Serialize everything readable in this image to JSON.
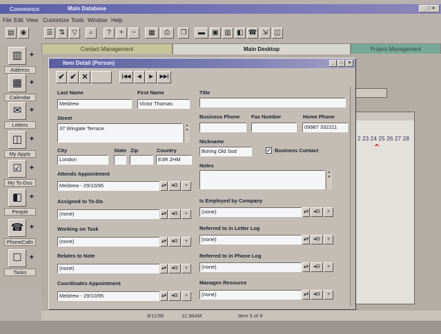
{
  "app": {
    "title_faded": "Commence",
    "title": "Main Database",
    "sys_buttons": "_ □ ×"
  },
  "menu": [
    "File",
    "Edit",
    "View",
    "Customize",
    "Tools",
    "Window",
    "Help"
  ],
  "toolbar_icons": [
    "open-icon",
    "filter-icon",
    "sort-icon",
    "search-icon",
    "help-icon",
    "add-icon",
    "remove-icon",
    "calendar-icon",
    "print-icon",
    "view-icon",
    "agent-icon",
    "phone-icon",
    "bar-icon"
  ],
  "tabs": {
    "left": "Contact Management",
    "center": "Main Desktop",
    "right": "Project Management"
  },
  "sidebar": [
    {
      "label": "Address",
      "icon": "address-book-icon",
      "glyph": "▥"
    },
    {
      "label": "Calendar",
      "icon": "calendar-icon",
      "glyph": "▦"
    },
    {
      "label": "Letters",
      "icon": "letters-icon",
      "glyph": "✉"
    },
    {
      "label": "My Appts",
      "icon": "appointments-icon",
      "glyph": "◫"
    },
    {
      "label": "My To-Dos",
      "icon": "todo-icon",
      "glyph": "☑"
    },
    {
      "label": "People",
      "icon": "people-icon",
      "glyph": "◧"
    },
    {
      "label": "PhoneCalls",
      "icon": "phone-icon",
      "glyph": "☎"
    },
    {
      "label": "Tasks",
      "icon": "tasks-icon",
      "glyph": "☐"
    }
  ],
  "background_calendar": {
    "days": "2 23 24 25 26 27 28"
  },
  "dialog": {
    "title": "Item Detail (Person)",
    "nav_buttons": [
      "✔",
      "✔",
      "✕",
      "",
      "|◀◀",
      "◀",
      "▶",
      "▶▶|"
    ],
    "fields": {
      "last_name_label": "Last Name",
      "last_name": "Meldrew",
      "first_name_label": "First Name",
      "first_name": "Victor Thomas",
      "title_label": "Title",
      "title": "",
      "street_label": "Street",
      "street": "37 Wingate Terrace",
      "business_phone_label": "Business Phone",
      "business_phone": "",
      "fax_label": "Fax Number",
      "fax": "",
      "home_phone_label": "Home Phone",
      "home_phone": "09987 332211",
      "nickname_label": "Nickname",
      "nickname": "Boring Old Sod",
      "business_contact_label": "Business Contact",
      "business_contact_checked": "✓",
      "city_label": "City",
      "city": "London",
      "state_label": "State",
      "state": "",
      "zip_label": "Zip",
      "zip": "",
      "country_label": "Country",
      "country": "E3R 2HM",
      "notes_label": "Notes",
      "notes": ""
    },
    "connections_left": [
      {
        "label": "Attends Appointment",
        "value": "Meldrew - 29/10/95"
      },
      {
        "label": "Assigned to To-Do",
        "value": "(none)"
      },
      {
        "label": "Working on Task",
        "value": "(none)"
      },
      {
        "label": "Relates to Note",
        "value": "(none)"
      },
      {
        "label": "Coordinates Appointment",
        "value": "Meldrew - 29/10/95"
      }
    ],
    "connections_right": [
      {
        "label": "Is Employed by Company",
        "value": "(none)"
      },
      {
        "label": "Referred to in Letter Log",
        "value": "(none)"
      },
      {
        "label": "Referred to in Phone Log",
        "value": "(none)"
      },
      {
        "label": "Manages Resource",
        "value": "(none)"
      }
    ]
  },
  "status": {
    "date": "8/11/95",
    "time": "11:38AM",
    "item": "Item 5 of 9"
  }
}
